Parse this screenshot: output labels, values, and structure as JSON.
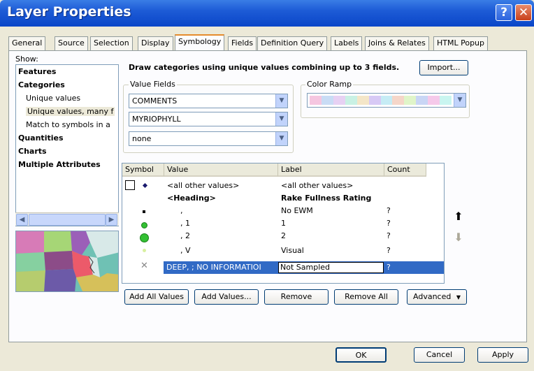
{
  "window": {
    "title": "Layer Properties"
  },
  "tabs": [
    "General",
    "Source",
    "Selection",
    "Display",
    "Symbology",
    "Fields",
    "Definition Query",
    "Labels",
    "Joins & Relates",
    "HTML Popup"
  ],
  "show": {
    "label": "Show:",
    "items": [
      "Features",
      "Categories",
      "Unique values",
      "Unique values, many f",
      "Match to symbols in a",
      "Quantities",
      "Charts",
      "Multiple Attributes"
    ]
  },
  "description": "Draw categories using unique values combining up to 3 fields.",
  "import_label": "Import...",
  "value_fields": {
    "label": "Value Fields",
    "field1": "COMMENTS",
    "field2": "MYRIOPHYLL",
    "field3": "none"
  },
  "color_ramp": {
    "label": "Color Ramp",
    "colors": [
      "#f5c6e0",
      "#c9dcf5",
      "#e7d1f3",
      "#c9f1e4",
      "#f4e6c8",
      "#d7c9f5",
      "#c6ecf5",
      "#f5d6c9",
      "#e0f5c9",
      "#c9d6f5",
      "#f5c9ea",
      "#c9f5f0"
    ]
  },
  "table": {
    "headers": [
      "Symbol",
      "Value",
      "Label",
      "Count"
    ],
    "rows": [
      {
        "value": "<all other values>",
        "label": "<all other values>",
        "count": ""
      },
      {
        "value": "<Heading>",
        "label": "Rake Fullness Rating",
        "count": ""
      },
      {
        "value": ",",
        "label": "No EWM",
        "count": "?"
      },
      {
        "value": ", 1",
        "label": "1",
        "count": "?"
      },
      {
        "value": ", 2",
        "label": "2",
        "count": "?"
      },
      {
        "value": ", V",
        "label": "Visual",
        "count": "?"
      },
      {
        "value": "DEEP, ; NO INFORMATIOI",
        "label": "Not Sampled",
        "count": "?"
      }
    ]
  },
  "buttons": {
    "add_all": "Add All Values",
    "add_values": "Add Values...",
    "remove": "Remove",
    "remove_all": "Remove All",
    "advanced": "Advanced"
  },
  "footer": {
    "ok": "OK",
    "cancel": "Cancel",
    "apply": "Apply"
  }
}
